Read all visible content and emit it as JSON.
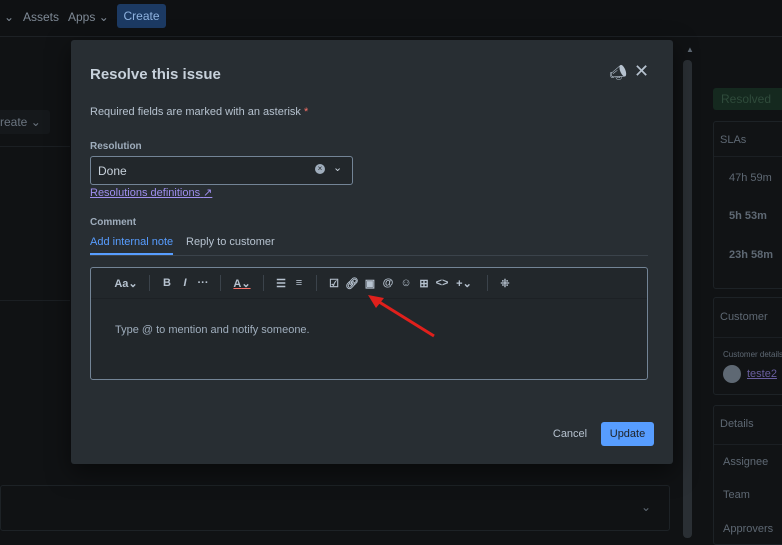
{
  "nav": {
    "assets": "Assets",
    "apps": "Apps",
    "create": "Create"
  },
  "background": {
    "create_partial": "reate",
    "status": "Resolved",
    "slas_title": "SLAs",
    "sla_times": [
      "47h 59m",
      "5h 53m",
      "23h 58m"
    ],
    "customer_title": "Customer",
    "customer_details": "Customer details",
    "customer_name": "teste2",
    "details_title": "Details",
    "details_fields": [
      "Assignee",
      "Team",
      "Approvers"
    ]
  },
  "modal": {
    "title": "Resolve this issue",
    "required_note": "Required fields are marked with an asterisk",
    "asterisk": "*",
    "resolution_label": "Resolution",
    "resolution_value": "Done",
    "resolutions_link": "Resolutions definitions",
    "comment_label": "Comment",
    "tabs": [
      {
        "label": "Add internal note",
        "active": true
      },
      {
        "label": "Reply to customer",
        "active": false
      }
    ],
    "toolbar": {
      "text_style": "Aa",
      "bold": "B",
      "italic": "I",
      "more": "···",
      "color": "A"
    },
    "placeholder": "Type @ to mention and notify someone.",
    "cancel": "Cancel",
    "update": "Update"
  },
  "colors": {
    "accent": "#579dff",
    "annotation_arrow": "#e0201c"
  }
}
